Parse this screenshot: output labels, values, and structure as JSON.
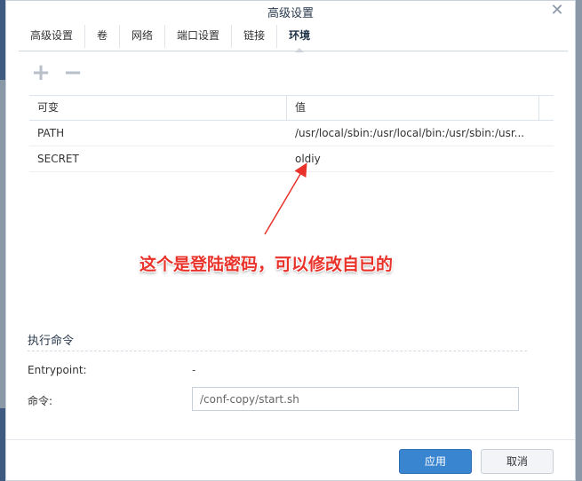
{
  "dialog": {
    "title": "高级设置"
  },
  "tabs": [
    {
      "label": "高级设置"
    },
    {
      "label": "卷"
    },
    {
      "label": "网络"
    },
    {
      "label": "端口设置"
    },
    {
      "label": "链接"
    },
    {
      "label": "环境",
      "active": true
    }
  ],
  "toolbar": {
    "add_icon": "plus-icon",
    "remove_icon": "minus-icon"
  },
  "env_table": {
    "columns": [
      "可变",
      "值"
    ],
    "rows": [
      {
        "name": "PATH",
        "value": "/usr/local/sbin:/usr/local/bin:/usr/sbin:/usr..."
      },
      {
        "name": "SECRET",
        "value": "oldiy"
      }
    ]
  },
  "exec": {
    "section_title": "执行命令",
    "entrypoint_label": "Entrypoint:",
    "entrypoint_value": "-",
    "command_label": "命令:",
    "command_value": "/conf-copy/start.sh"
  },
  "footer": {
    "apply_label": "应用",
    "cancel_label": "取消"
  },
  "annotation": {
    "text": "这个是登陆密码，可以修改自已的"
  },
  "colors": {
    "primary": "#3a85d0",
    "annotation": "#e8322a"
  }
}
